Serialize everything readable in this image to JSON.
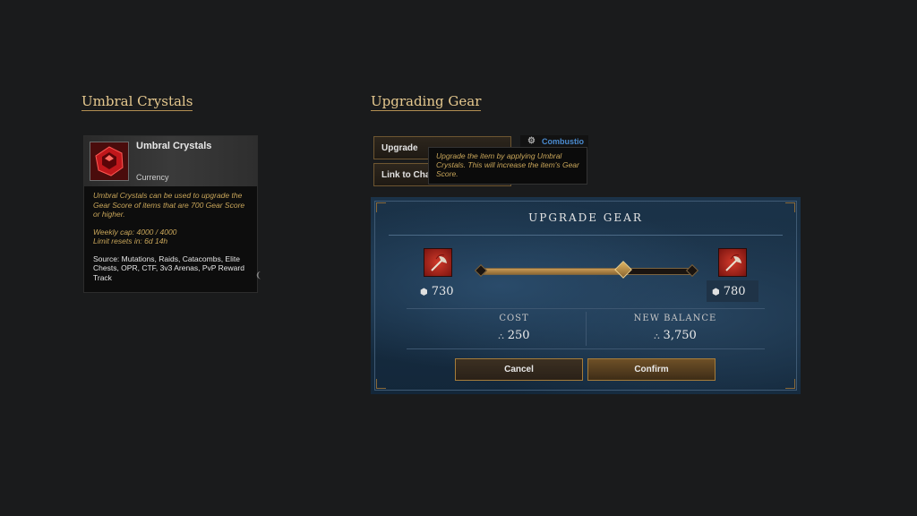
{
  "sections": {
    "left_title": "Umbral Crystals",
    "right_title": "Upgrading Gear"
  },
  "crystal_tooltip": {
    "name": "Umbral Crystals",
    "type": "Currency",
    "description": "Umbral Crystals can be used to upgrade the Gear Score of items that are 700 Gear Score or higher.",
    "weekly_cap": "Weekly cap: 4000 / 4000",
    "limit_reset": "Limit resets in: 6d 14h",
    "source_label": "Source:",
    "source_text": "Mutations, Raids, Catacombs, Elite Chests, OPR, CTF, 3v3 Arenas, PvP Reward Track",
    "icon": "umbral-crystal-icon"
  },
  "context_menu": {
    "upgrade_label": "Upgrade",
    "link_label": "Link to Cha",
    "combustion_label": "Combustio",
    "tooltip": "Upgrade the item by applying Umbral Crystals. This will increase the item's Gear Score."
  },
  "upgrade_dialog": {
    "title": "UPGRADE GEAR",
    "current_gear_score": "730",
    "new_gear_score": "780",
    "cost_label": "COST",
    "cost_value": "250",
    "balance_label": "NEW BALANCE",
    "balance_value": "3,750",
    "progress": 0.67,
    "cancel_label": "Cancel",
    "confirm_label": "Confirm",
    "item_icon": "axe-icon"
  }
}
